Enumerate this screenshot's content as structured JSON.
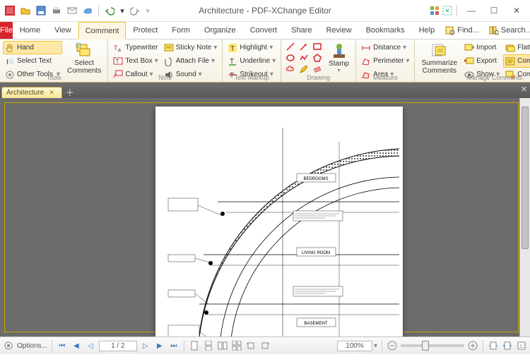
{
  "title": "Architecture - PDF-XChange Editor",
  "menubar": {
    "file": "File",
    "tabs": [
      "Home",
      "View",
      "Comment",
      "Protect",
      "Form",
      "Organize",
      "Convert",
      "Share",
      "Review",
      "Bookmarks",
      "Help"
    ],
    "active": "Comment",
    "find": "Find...",
    "search": "Search..."
  },
  "ribbon": {
    "tools": {
      "label": "Tools",
      "hand": "Hand",
      "select_text": "Select Text",
      "other_tools": "Other Tools",
      "select_comments": "Select\nComments"
    },
    "note": {
      "label": "Note",
      "typewriter": "Typewriter",
      "textbox": "Text Box",
      "callout": "Callout",
      "sticky": "Sticky Note",
      "attach": "Attach File",
      "sound": "Sound"
    },
    "text_markup": {
      "label": "Text Markup",
      "highlight": "Highlight",
      "underline": "Underline",
      "strikeout": "Strikeout"
    },
    "drawing": {
      "label": "Drawing",
      "stamp": "Stamp"
    },
    "measure": {
      "label": "Measure",
      "distance": "Distance",
      "perimeter": "Perimeter",
      "area": "Area"
    },
    "manage": {
      "label": "Manage Comments",
      "summarize": "Summarize\nComments",
      "show": "Show",
      "import": "Import",
      "export": "Export",
      "comments_list": "Comments List",
      "flatten": "Flatten",
      "styles": "Comment Styles"
    }
  },
  "doctab": {
    "name": "Architecture"
  },
  "drawing_labels": {
    "bedrooms": "BEDROOMS",
    "living": "LIVING ROOM",
    "basement": "BASEMENT"
  },
  "status": {
    "options": "Options...",
    "page": "1 / 2",
    "zoom": "100%"
  }
}
